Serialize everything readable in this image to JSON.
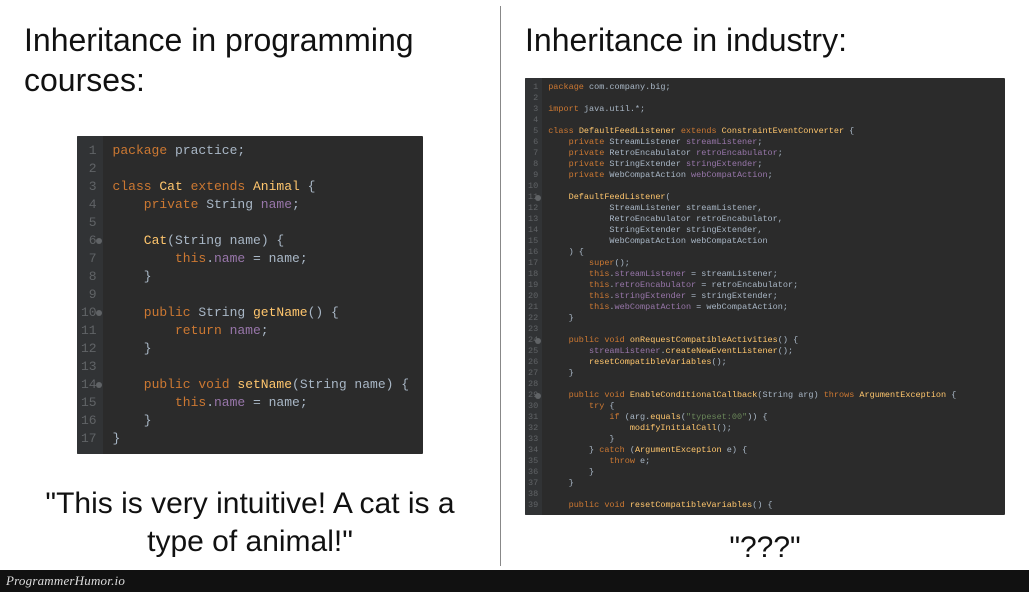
{
  "left": {
    "title": "Inheritance in programming courses:",
    "caption": "\"This is very intuitive! A cat is a type of animal!\"",
    "code": {
      "lines": [
        [
          {
            "c": "kw",
            "t": "package "
          },
          {
            "c": "pkg",
            "t": "practice"
          },
          {
            "c": "op",
            "t": ";"
          }
        ],
        [],
        [
          {
            "c": "kw",
            "t": "class "
          },
          {
            "c": "cls",
            "t": "Cat"
          },
          {
            "c": "kw",
            "t": " extends "
          },
          {
            "c": "cls",
            "t": "Animal"
          },
          {
            "c": "op",
            "t": " {"
          }
        ],
        [
          {
            "t": "    "
          },
          {
            "c": "kw",
            "t": "private "
          },
          {
            "c": "type",
            "t": "String "
          },
          {
            "c": "field",
            "t": "name"
          },
          {
            "c": "op",
            "t": ";"
          }
        ],
        [],
        [
          {
            "t": "    "
          },
          {
            "c": "fn",
            "t": "Cat"
          },
          {
            "c": "op",
            "t": "("
          },
          {
            "c": "type",
            "t": "String "
          },
          {
            "c": "param",
            "t": "name"
          },
          {
            "c": "op",
            "t": ") {"
          }
        ],
        [
          {
            "t": "        "
          },
          {
            "c": "kw",
            "t": "this"
          },
          {
            "c": "op",
            "t": "."
          },
          {
            "c": "field",
            "t": "name"
          },
          {
            "c": "op",
            "t": " = "
          },
          {
            "c": "var",
            "t": "name"
          },
          {
            "c": "op",
            "t": ";"
          }
        ],
        [
          {
            "t": "    "
          },
          {
            "c": "op",
            "t": "}"
          }
        ],
        [],
        [
          {
            "t": "    "
          },
          {
            "c": "kw",
            "t": "public "
          },
          {
            "c": "type",
            "t": "String "
          },
          {
            "c": "fn",
            "t": "getName"
          },
          {
            "c": "op",
            "t": "() {"
          }
        ],
        [
          {
            "t": "        "
          },
          {
            "c": "kw",
            "t": "return "
          },
          {
            "c": "field",
            "t": "name"
          },
          {
            "c": "op",
            "t": ";"
          }
        ],
        [
          {
            "t": "    "
          },
          {
            "c": "op",
            "t": "}"
          }
        ],
        [],
        [
          {
            "t": "    "
          },
          {
            "c": "kw",
            "t": "public void "
          },
          {
            "c": "fn",
            "t": "setName"
          },
          {
            "c": "op",
            "t": "("
          },
          {
            "c": "type",
            "t": "String "
          },
          {
            "c": "param",
            "t": "name"
          },
          {
            "c": "op",
            "t": ") {"
          }
        ],
        [
          {
            "t": "        "
          },
          {
            "c": "kw",
            "t": "this"
          },
          {
            "c": "op",
            "t": "."
          },
          {
            "c": "field",
            "t": "name"
          },
          {
            "c": "op",
            "t": " = "
          },
          {
            "c": "var",
            "t": "name"
          },
          {
            "c": "op",
            "t": ";"
          }
        ],
        [
          {
            "t": "    "
          },
          {
            "c": "op",
            "t": "}"
          }
        ],
        [
          {
            "c": "op",
            "t": "}"
          }
        ]
      ],
      "markers": [
        6,
        10,
        14
      ]
    }
  },
  "right": {
    "title": "Inheritance in industry:",
    "caption": "\"???\"",
    "code": {
      "lines": [
        [
          {
            "c": "kw",
            "t": "package "
          },
          {
            "c": "pkg",
            "t": "com.company.big"
          },
          {
            "c": "op",
            "t": ";"
          }
        ],
        [],
        [
          {
            "c": "kw",
            "t": "import "
          },
          {
            "c": "pkg",
            "t": "java.util.*"
          },
          {
            "c": "op",
            "t": ";"
          }
        ],
        [],
        [
          {
            "c": "kw",
            "t": "class "
          },
          {
            "c": "cls",
            "t": "DefaultFeedListener"
          },
          {
            "c": "kw",
            "t": " extends "
          },
          {
            "c": "cls",
            "t": "ConstraintEventConverter"
          },
          {
            "c": "op",
            "t": " {"
          }
        ],
        [
          {
            "t": "    "
          },
          {
            "c": "kw",
            "t": "private "
          },
          {
            "c": "type",
            "t": "StreamListener "
          },
          {
            "c": "field",
            "t": "streamListener"
          },
          {
            "c": "op",
            "t": ";"
          }
        ],
        [
          {
            "t": "    "
          },
          {
            "c": "kw",
            "t": "private "
          },
          {
            "c": "type",
            "t": "RetroEncabulator "
          },
          {
            "c": "field",
            "t": "retroEncabulator"
          },
          {
            "c": "op",
            "t": ";"
          }
        ],
        [
          {
            "t": "    "
          },
          {
            "c": "kw",
            "t": "private "
          },
          {
            "c": "type",
            "t": "StringExtender "
          },
          {
            "c": "field",
            "t": "stringExtender"
          },
          {
            "c": "op",
            "t": ";"
          }
        ],
        [
          {
            "t": "    "
          },
          {
            "c": "kw",
            "t": "private "
          },
          {
            "c": "type",
            "t": "WebCompatAction "
          },
          {
            "c": "field",
            "t": "webCompatAction"
          },
          {
            "c": "op",
            "t": ";"
          }
        ],
        [],
        [
          {
            "t": "    "
          },
          {
            "c": "fn",
            "t": "DefaultFeedListener"
          },
          {
            "c": "op",
            "t": "("
          }
        ],
        [
          {
            "t": "            "
          },
          {
            "c": "type",
            "t": "StreamListener "
          },
          {
            "c": "param",
            "t": "streamListener"
          },
          {
            "c": "op",
            "t": ","
          }
        ],
        [
          {
            "t": "            "
          },
          {
            "c": "type",
            "t": "RetroEncabulator "
          },
          {
            "c": "param",
            "t": "retroEncabulator"
          },
          {
            "c": "op",
            "t": ","
          }
        ],
        [
          {
            "t": "            "
          },
          {
            "c": "type",
            "t": "StringExtender "
          },
          {
            "c": "param",
            "t": "stringExtender"
          },
          {
            "c": "op",
            "t": ","
          }
        ],
        [
          {
            "t": "            "
          },
          {
            "c": "type",
            "t": "WebCompatAction "
          },
          {
            "c": "param",
            "t": "webCompatAction"
          }
        ],
        [
          {
            "t": "    "
          },
          {
            "c": "op",
            "t": ") {"
          }
        ],
        [
          {
            "t": "        "
          },
          {
            "c": "kw",
            "t": "super"
          },
          {
            "c": "op",
            "t": "();"
          }
        ],
        [
          {
            "t": "        "
          },
          {
            "c": "kw",
            "t": "this"
          },
          {
            "c": "op",
            "t": "."
          },
          {
            "c": "field",
            "t": "streamListener"
          },
          {
            "c": "op",
            "t": " = "
          },
          {
            "c": "var",
            "t": "streamListener"
          },
          {
            "c": "op",
            "t": ";"
          }
        ],
        [
          {
            "t": "        "
          },
          {
            "c": "kw",
            "t": "this"
          },
          {
            "c": "op",
            "t": "."
          },
          {
            "c": "field",
            "t": "retroEncabulator"
          },
          {
            "c": "op",
            "t": " = "
          },
          {
            "c": "var",
            "t": "retroEncabulator"
          },
          {
            "c": "op",
            "t": ";"
          }
        ],
        [
          {
            "t": "        "
          },
          {
            "c": "kw",
            "t": "this"
          },
          {
            "c": "op",
            "t": "."
          },
          {
            "c": "field",
            "t": "stringExtender"
          },
          {
            "c": "op",
            "t": " = "
          },
          {
            "c": "var",
            "t": "stringExtender"
          },
          {
            "c": "op",
            "t": ";"
          }
        ],
        [
          {
            "t": "        "
          },
          {
            "c": "kw",
            "t": "this"
          },
          {
            "c": "op",
            "t": "."
          },
          {
            "c": "field",
            "t": "webCompatAction"
          },
          {
            "c": "op",
            "t": " = "
          },
          {
            "c": "var",
            "t": "webCompatAction"
          },
          {
            "c": "op",
            "t": ";"
          }
        ],
        [
          {
            "t": "    "
          },
          {
            "c": "op",
            "t": "}"
          }
        ],
        [],
        [
          {
            "t": "    "
          },
          {
            "c": "kw",
            "t": "public void "
          },
          {
            "c": "fn",
            "t": "onRequestCompatibleActivities"
          },
          {
            "c": "op",
            "t": "() {"
          }
        ],
        [
          {
            "t": "        "
          },
          {
            "c": "field",
            "t": "streamListener"
          },
          {
            "c": "op",
            "t": "."
          },
          {
            "c": "fn",
            "t": "createNewEventListener"
          },
          {
            "c": "op",
            "t": "();"
          }
        ],
        [
          {
            "t": "        "
          },
          {
            "c": "fn",
            "t": "resetCompatibleVariables"
          },
          {
            "c": "op",
            "t": "();"
          }
        ],
        [
          {
            "t": "    "
          },
          {
            "c": "op",
            "t": "}"
          }
        ],
        [],
        [
          {
            "t": "    "
          },
          {
            "c": "kw",
            "t": "public void "
          },
          {
            "c": "fn",
            "t": "EnableConditionalCallback"
          },
          {
            "c": "op",
            "t": "("
          },
          {
            "c": "type",
            "t": "String "
          },
          {
            "c": "param",
            "t": "arg"
          },
          {
            "c": "op",
            "t": ") "
          },
          {
            "c": "kw",
            "t": "throws "
          },
          {
            "c": "cls",
            "t": "ArgumentException"
          },
          {
            "c": "op",
            "t": " {"
          }
        ],
        [
          {
            "t": "        "
          },
          {
            "c": "kw",
            "t": "try"
          },
          {
            "c": "op",
            "t": " {"
          }
        ],
        [
          {
            "t": "            "
          },
          {
            "c": "kw",
            "t": "if"
          },
          {
            "c": "op",
            "t": " ("
          },
          {
            "c": "var",
            "t": "arg"
          },
          {
            "c": "op",
            "t": "."
          },
          {
            "c": "fn",
            "t": "equals"
          },
          {
            "c": "op",
            "t": "("
          },
          {
            "c": "str",
            "t": "\"typeset:00\""
          },
          {
            "c": "op",
            "t": ")) {"
          }
        ],
        [
          {
            "t": "                "
          },
          {
            "c": "fn",
            "t": "modifyInitialCall"
          },
          {
            "c": "op",
            "t": "();"
          }
        ],
        [
          {
            "t": "            "
          },
          {
            "c": "op",
            "t": "}"
          }
        ],
        [
          {
            "t": "        "
          },
          {
            "c": "op",
            "t": "} "
          },
          {
            "c": "kw",
            "t": "catch"
          },
          {
            "c": "op",
            "t": " ("
          },
          {
            "c": "cls",
            "t": "ArgumentException"
          },
          {
            "c": "op",
            "t": " "
          },
          {
            "c": "var",
            "t": "e"
          },
          {
            "c": "op",
            "t": ") {"
          }
        ],
        [
          {
            "t": "            "
          },
          {
            "c": "kw",
            "t": "throw "
          },
          {
            "c": "var",
            "t": "e"
          },
          {
            "c": "op",
            "t": ";"
          }
        ],
        [
          {
            "t": "        "
          },
          {
            "c": "op",
            "t": "}"
          }
        ],
        [
          {
            "t": "    "
          },
          {
            "c": "op",
            "t": "}"
          }
        ],
        [],
        [
          {
            "t": "    "
          },
          {
            "c": "kw",
            "t": "public void "
          },
          {
            "c": "fn",
            "t": "resetCompatibleVariables"
          },
          {
            "c": "op",
            "t": "() {"
          }
        ]
      ],
      "markers": [
        11,
        24,
        29
      ]
    }
  },
  "footer": "ProgrammerHumor.io"
}
